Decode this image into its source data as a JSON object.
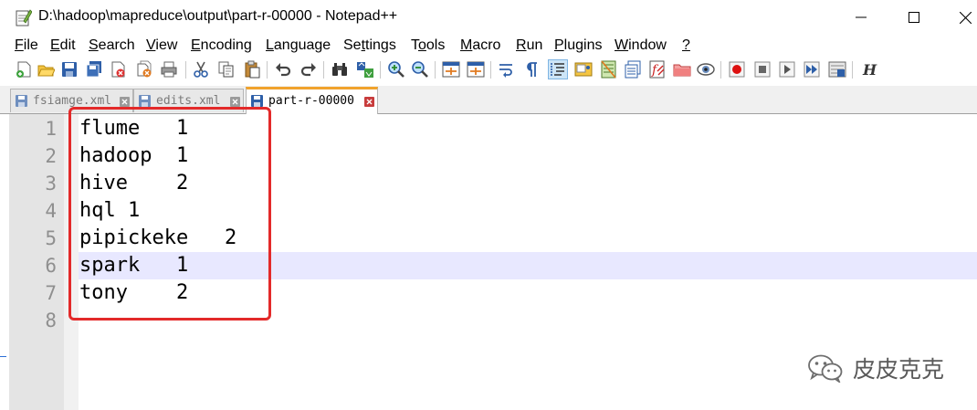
{
  "window": {
    "title": "D:\\hadoop\\mapreduce\\output\\part-r-00000 - Notepad++",
    "minimize_icon": "minimize-icon",
    "maximize_icon": "maximize-icon",
    "close_icon": "close-icon"
  },
  "menu": [
    {
      "key": "file",
      "acc": "F",
      "rest": "ile"
    },
    {
      "key": "edit",
      "acc": "E",
      "rest": "dit"
    },
    {
      "key": "search",
      "acc": "S",
      "rest": "earch"
    },
    {
      "key": "view",
      "acc": "V",
      "rest": "iew"
    },
    {
      "key": "encoding",
      "acc": "E",
      "rest": "ncoding"
    },
    {
      "key": "language",
      "acc": "L",
      "rest": "anguage"
    },
    {
      "key": "settings",
      "pre": "Se",
      "acc": "t",
      "rest": "tings"
    },
    {
      "key": "tools",
      "pre": "T",
      "acc": "o",
      "rest": "ols"
    },
    {
      "key": "macro",
      "acc": "M",
      "rest": "acro"
    },
    {
      "key": "run",
      "acc": "R",
      "rest": "un"
    },
    {
      "key": "plugins",
      "acc": "P",
      "rest": "lugins"
    },
    {
      "key": "window",
      "acc": "W",
      "rest": "indow"
    },
    {
      "key": "help",
      "acc": "?",
      "rest": ""
    }
  ],
  "toolbar_icons": [
    "new-file-icon",
    "open-file-icon",
    "save-icon",
    "save-all-icon",
    "close-icon",
    "close-all-icon",
    "print-icon",
    "cut-icon",
    "copy-icon",
    "paste-icon",
    "undo-icon",
    "redo-icon",
    "find-icon",
    "replace-icon",
    "zoom-in-icon",
    "zoom-out-icon",
    "sync-vertical-icon",
    "sync-horizontal-icon",
    "word-wrap-icon",
    "show-all-characters-icon",
    "indent-guide-icon",
    "language-udl-icon",
    "document-map-icon",
    "document-list-icon",
    "function-list-icon",
    "folder-as-workspace-icon",
    "monitoring-icon",
    "record-macro-icon",
    "stop-recording-icon",
    "play-macro-icon",
    "run-macro-multiple-icon",
    "save-macro-icon",
    "heading-icon"
  ],
  "tabs": [
    {
      "label": "fsiamge.xml",
      "active": false
    },
    {
      "label": "edits.xml",
      "active": false
    },
    {
      "label": "part-r-00000",
      "active": true
    }
  ],
  "editor": {
    "line_numbers": [
      "1",
      "2",
      "3",
      "4",
      "5",
      "6",
      "7",
      "8"
    ],
    "lines": [
      "flume   1",
      "hadoop  1",
      "hive    2",
      "hql 1",
      "pipickeke   2",
      "spark   1",
      "tony    2",
      ""
    ],
    "current_line": 6
  },
  "watermark": {
    "text": "皮皮克克",
    "icon": "wechat-icon"
  },
  "colors": {
    "annotation": "#e32a2a",
    "current_line_bg": "#e8e8ff",
    "active_tab_accent": "#f1a32c"
  }
}
